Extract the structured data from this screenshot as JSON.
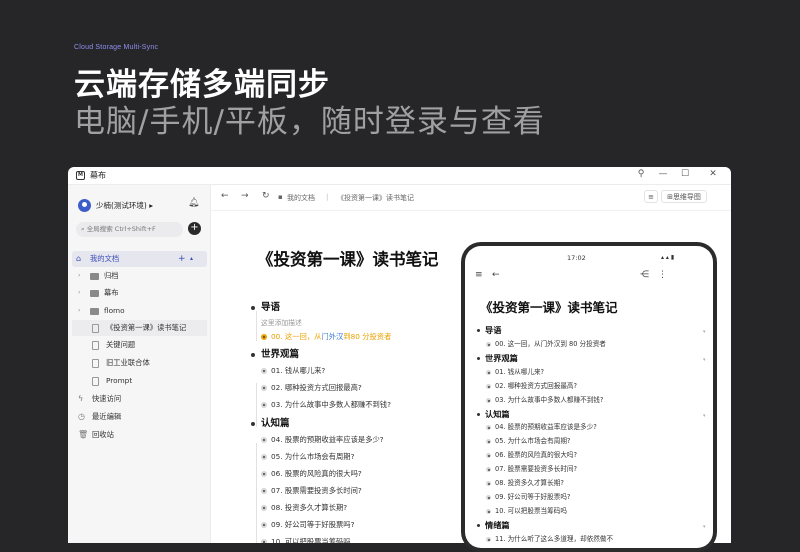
{
  "hero": {
    "tag": "Cloud Storage Multi-Sync",
    "headline": "云端存储多端同步",
    "subheadline": "电脑/手机/平板，随时登录与查看"
  },
  "app": {
    "title": "幕布",
    "window_controls": {
      "pin": "⚲",
      "minimize": "—",
      "maximize": "☐",
      "close": "✕"
    }
  },
  "sidebar": {
    "user": "少楠(测试环境) ▸",
    "search_placeholder": "全局搜索 Ctrl+Shift+F",
    "add": "+",
    "my_docs": "我的文档",
    "folders": [
      "归档",
      "幕布",
      "flomo"
    ],
    "docs": [
      "《投资第一课》读书笔记",
      "关键问题",
      "旧工业联合体",
      "Prompt"
    ],
    "quick_access": "快速访问",
    "recent": "最近编辑",
    "trash": "回收站"
  },
  "toolbar": {
    "breadcrumb_root": "我的文档",
    "breadcrumb_sep": "|",
    "breadcrumb_doc": "《投资第一课》读书笔记",
    "mindmap": "思维导图"
  },
  "document": {
    "title": "《投资第一课》读书笔记",
    "sections": [
      {
        "heading": "导语",
        "note": "这里添加描述",
        "items": [
          "00. 这一回，从门外汉到 80 分投资者"
        ]
      },
      {
        "heading": "世界观篇",
        "items": [
          "01. 钱从哪儿来?",
          "02. 哪种投资方式回报最高?",
          "03. 为什么故事中多数人都赚不到钱?"
        ]
      },
      {
        "heading": "认知篇",
        "items": [
          "04. 股票的预期收益率应该是多少?",
          "05. 为什么市场会有周期?",
          "06. 股票的风险真的很大吗?",
          "07. 股票需要投资多长时间?",
          "08. 投资多久才算长期?",
          "09. 好公司等于好股票吗?",
          "10. 可以把股票当筹码吗"
        ]
      }
    ],
    "highlight": {
      "prefix": "00. 这一回，从",
      "link1": "门外汉",
      "mid": "到",
      "link2": "80 分投资者"
    }
  },
  "phone": {
    "time": "17:02",
    "status": "▴ ▴ ▮",
    "title": "《投资第一课》读书笔记",
    "sections": [
      {
        "heading": "导语",
        "items": [
          "00. 这一回，从门外汉到 80 分投资者"
        ]
      },
      {
        "heading": "世界观篇",
        "items": [
          "01. 钱从哪儿来?",
          "02. 哪种投资方式回报最高?",
          "03. 为什么故事中多数人都赚不到钱?"
        ]
      },
      {
        "heading": "认知篇",
        "items": [
          "04. 股票的预期收益率应该是多少?",
          "05. 为什么市场会有周期?",
          "06. 股票的风险真的很大吗?",
          "07. 股票需要投资多长时间?",
          "08. 投资多久才算长期?",
          "09. 好公司等于好股票吗?",
          "10. 可以把股票当筹码吗"
        ]
      },
      {
        "heading": "情绪篇",
        "items": [
          "11. 为什么听了这么多道理，却依然做不"
        ]
      }
    ]
  },
  "colors": {
    "accent": "#3d4fb8",
    "highlight": "#e8a200",
    "link": "#3a7bd5"
  }
}
